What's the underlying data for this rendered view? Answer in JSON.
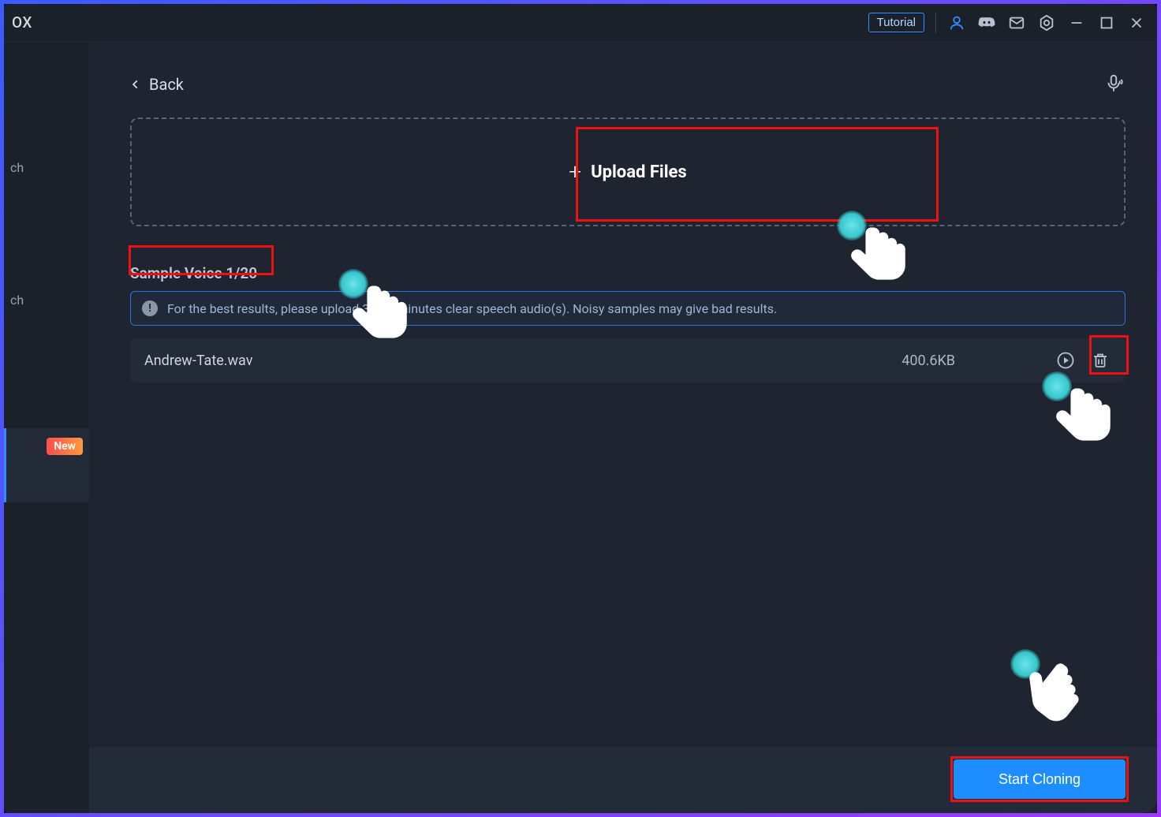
{
  "titlebar": {
    "app_fragment": "OX",
    "tutorial_label": "Tutorial"
  },
  "sidebar": {
    "fragment1": "ch",
    "fragment2": "ch",
    "new_badge": "New"
  },
  "back": {
    "label": "Back"
  },
  "upload": {
    "label": "Upload Files",
    "plus": "+"
  },
  "sample_heading": "Sample Voice 1/20",
  "info_text": "For the best results, please upload 3 to 5 minutes clear speech audio(s). Noisy samples may give bad results.",
  "file": {
    "name": "Andrew-Tate.wav",
    "size": "400.6KB"
  },
  "start_button": "Start Cloning"
}
